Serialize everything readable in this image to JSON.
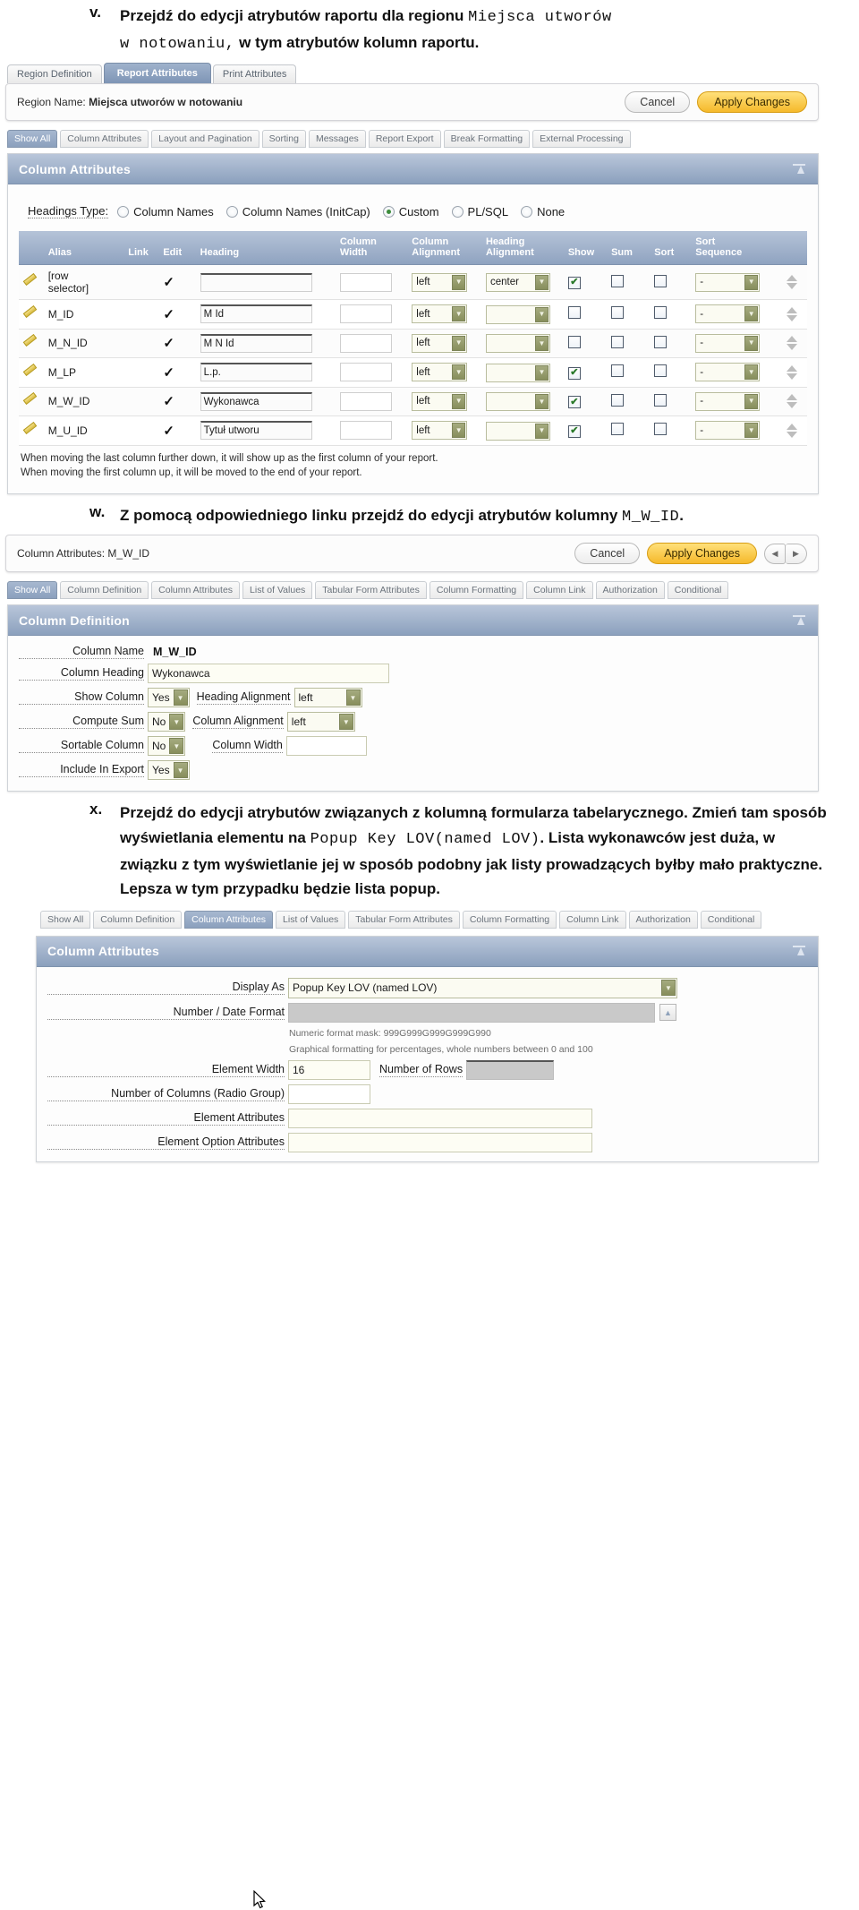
{
  "steps": {
    "v": {
      "marker": "v.",
      "text_1": "Przejdź do edycji atrybutów raportu dla regionu ",
      "mono_1": "Miejsca utworów",
      "mono_2": "w notowaniu,",
      "text_2": " w tym atrybutów kolumn raportu."
    },
    "w": {
      "marker": "w.",
      "text_1": "Z pomocą odpowiedniego linku przejdź do edycji atrybutów kolumny ",
      "mono_1": "M_W_ID",
      "text_2": "."
    },
    "x": {
      "marker": "x.",
      "text_1": "Przejdź do edycji atrybutów związanych z kolumną formularza tabelarycznego. Zmień tam sposób wyświetlania elementu na ",
      "mono_1": "Popup Key LOV(named LOV)",
      "text_2": ". Lista wykonawców jest duża, w związku z tym wyświetlanie jej w sposób podobny jak listy prowadzących byłby mało praktyczne. Lepsza w tym przypadku będzie lista popup."
    }
  },
  "shot1": {
    "region_tabs": [
      {
        "label": "Region Definition",
        "active": false
      },
      {
        "label": "Report Attributes",
        "active": true
      },
      {
        "label": "Print Attributes",
        "active": false
      }
    ],
    "titlebar": {
      "label": "Region Name:",
      "value": "Miejsca utworów w notowaniu",
      "cancel": "Cancel",
      "apply": "Apply Changes"
    },
    "sub_tabs": [
      {
        "label": "Show All",
        "active": true
      },
      {
        "label": "Column Attributes",
        "active": false
      },
      {
        "label": "Layout and Pagination",
        "active": false
      },
      {
        "label": "Sorting",
        "active": false
      },
      {
        "label": "Messages",
        "active": false
      },
      {
        "label": "Report Export",
        "active": false
      },
      {
        "label": "Break Formatting",
        "active": false
      },
      {
        "label": "External Processing",
        "active": false
      }
    ],
    "panel_title": "Column Attributes",
    "headings_type": {
      "label": "Headings Type:",
      "options": [
        {
          "label": "Column Names",
          "selected": false
        },
        {
          "label": "Column Names (InitCap)",
          "selected": false
        },
        {
          "label": "Custom",
          "selected": true
        },
        {
          "label": "PL/SQL",
          "selected": false
        },
        {
          "label": "None",
          "selected": false
        }
      ]
    },
    "table": {
      "columns": [
        "Alias",
        "Link",
        "Edit",
        "Heading",
        "Column Width",
        "Column Alignment",
        "Heading Alignment",
        "Show",
        "Sum",
        "Sort",
        "Sort Sequence"
      ],
      "rows": [
        {
          "alias": "[row selector]",
          "edit": "✓",
          "heading": "&nbsp;",
          "width": "",
          "col_align": "left",
          "head_align": "center",
          "show": true,
          "sum": false,
          "sort": false,
          "sort_seq": "-"
        },
        {
          "alias": "M_ID",
          "edit": "✓",
          "heading": "M Id",
          "width": "",
          "col_align": "left",
          "head_align": "",
          "show": false,
          "sum": false,
          "sort": false,
          "sort_seq": "-"
        },
        {
          "alias": "M_N_ID",
          "edit": "✓",
          "heading": "M N Id",
          "width": "",
          "col_align": "left",
          "head_align": "",
          "show": false,
          "sum": false,
          "sort": false,
          "sort_seq": "-"
        },
        {
          "alias": "M_LP",
          "edit": "✓",
          "heading": "L.p.",
          "width": "",
          "col_align": "left",
          "head_align": "",
          "show": true,
          "sum": false,
          "sort": false,
          "sort_seq": "-"
        },
        {
          "alias": "M_W_ID",
          "edit": "✓",
          "heading": "Wykonawca",
          "width": "",
          "col_align": "left",
          "head_align": "",
          "show": true,
          "sum": false,
          "sort": false,
          "sort_seq": "-"
        },
        {
          "alias": "M_U_ID",
          "edit": "✓",
          "heading": "Tytuł utworu",
          "width": "",
          "col_align": "left",
          "head_align": "",
          "show": true,
          "sum": false,
          "sort": false,
          "sort_seq": "-"
        }
      ]
    },
    "notes_line1": "When moving the last column further down, it will show up as the first column of your report.",
    "notes_line2": "When moving the first column up, it will be moved to the end of your report."
  },
  "shot2": {
    "titlebar": {
      "label": "Column Attributes:",
      "value": "M_W_ID",
      "cancel": "Cancel",
      "apply": "Apply Changes"
    },
    "sub_tabs": [
      {
        "label": "Show All",
        "active": true
      },
      {
        "label": "Column Definition",
        "active": false
      },
      {
        "label": "Column Attributes",
        "active": false
      },
      {
        "label": "List of Values",
        "active": false
      },
      {
        "label": "Tabular Form Attributes",
        "active": false
      },
      {
        "label": "Column Formatting",
        "active": false
      },
      {
        "label": "Column Link",
        "active": false
      },
      {
        "label": "Authorization",
        "active": false
      },
      {
        "label": "Conditional",
        "active": false
      }
    ],
    "panel_title": "Column Definition",
    "fields": {
      "column_name_label": "Column Name",
      "column_name_value": "M_W_ID",
      "column_heading_label": "Column Heading",
      "column_heading_value": "Wykonawca",
      "show_column_label": "Show Column",
      "show_column_value": "Yes",
      "heading_alignment_label": "Heading Alignment",
      "heading_alignment_value": "left",
      "compute_sum_label": "Compute Sum",
      "compute_sum_value": "No",
      "column_alignment_label": "Column Alignment",
      "column_alignment_value": "left",
      "sortable_column_label": "Sortable Column",
      "sortable_column_value": "No",
      "column_width_label": "Column Width",
      "column_width_value": "",
      "include_in_export_label": "Include In Export",
      "include_in_export_value": "Yes"
    }
  },
  "shot3": {
    "sub_tabs": [
      {
        "label": "Show All",
        "active": false
      },
      {
        "label": "Column Definition",
        "active": false
      },
      {
        "label": "Column Attributes",
        "active": true
      },
      {
        "label": "List of Values",
        "active": false
      },
      {
        "label": "Tabular Form Attributes",
        "active": false
      },
      {
        "label": "Column Formatting",
        "active": false
      },
      {
        "label": "Column Link",
        "active": false
      },
      {
        "label": "Authorization",
        "active": false
      },
      {
        "label": "Conditional",
        "active": false
      }
    ],
    "panel_title": "Column Attributes",
    "fields": {
      "display_as_label": "Display As",
      "display_as_value": "Popup Key LOV (named LOV)",
      "number_date_format_label": "Number / Date Format",
      "number_date_format_value": "",
      "hint_1": "Numeric format mask: 999G999G999G999G990",
      "hint_2": "Graphical formatting for percentages, whole numbers between 0 and 100",
      "element_width_label": "Element Width",
      "element_width_value": "16",
      "number_of_rows_label": "Number of Rows",
      "number_of_rows_value": "",
      "number_of_columns_label": "Number of Columns (Radio Group)",
      "number_of_columns_value": "",
      "element_attributes_label": "Element Attributes",
      "element_attributes_value": "",
      "element_option_attributes_label": "Element Option Attributes",
      "element_option_attributes_value": ""
    }
  }
}
